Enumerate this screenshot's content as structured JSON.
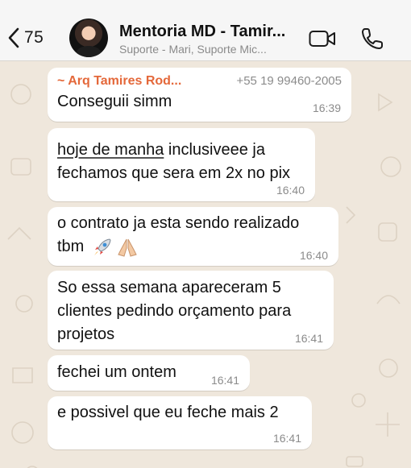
{
  "header": {
    "back_count": "75",
    "title": "Mentoria MD - Tamir...",
    "subtitle": "Suporte - Mari, Suporte Mic..."
  },
  "messages": [
    {
      "sender": "~ Arq Tamires Rod...",
      "phone": "+55 19 99460-2005",
      "text": "Conseguii simm",
      "time": "16:39"
    },
    {
      "text_underlined": "hoje de manha",
      "text_rest": " inclusiveee ja",
      "text_line2": "fechamos que sera em 2x no pix",
      "time": "16:40"
    },
    {
      "text": "o contrato ja esta sendo realizado",
      "text_line2": "tbm",
      "emojis": [
        "rocket-emoji",
        "folded-hands-emoji"
      ],
      "time": "16:40"
    },
    {
      "text": "So essa semana apareceram 5",
      "text_line2": "clientes pedindo orçamento para",
      "text_line3": "projetos",
      "time": "16:41"
    },
    {
      "text": "fechei um ontem",
      "time": "16:41"
    },
    {
      "text": "e possivel que eu feche mais 2",
      "time": "16:41"
    }
  ],
  "colors": {
    "sender": "#e4683a",
    "chat_background": "#efe7dc",
    "bubble": "#ffffff",
    "header": "#f6f6f6"
  }
}
